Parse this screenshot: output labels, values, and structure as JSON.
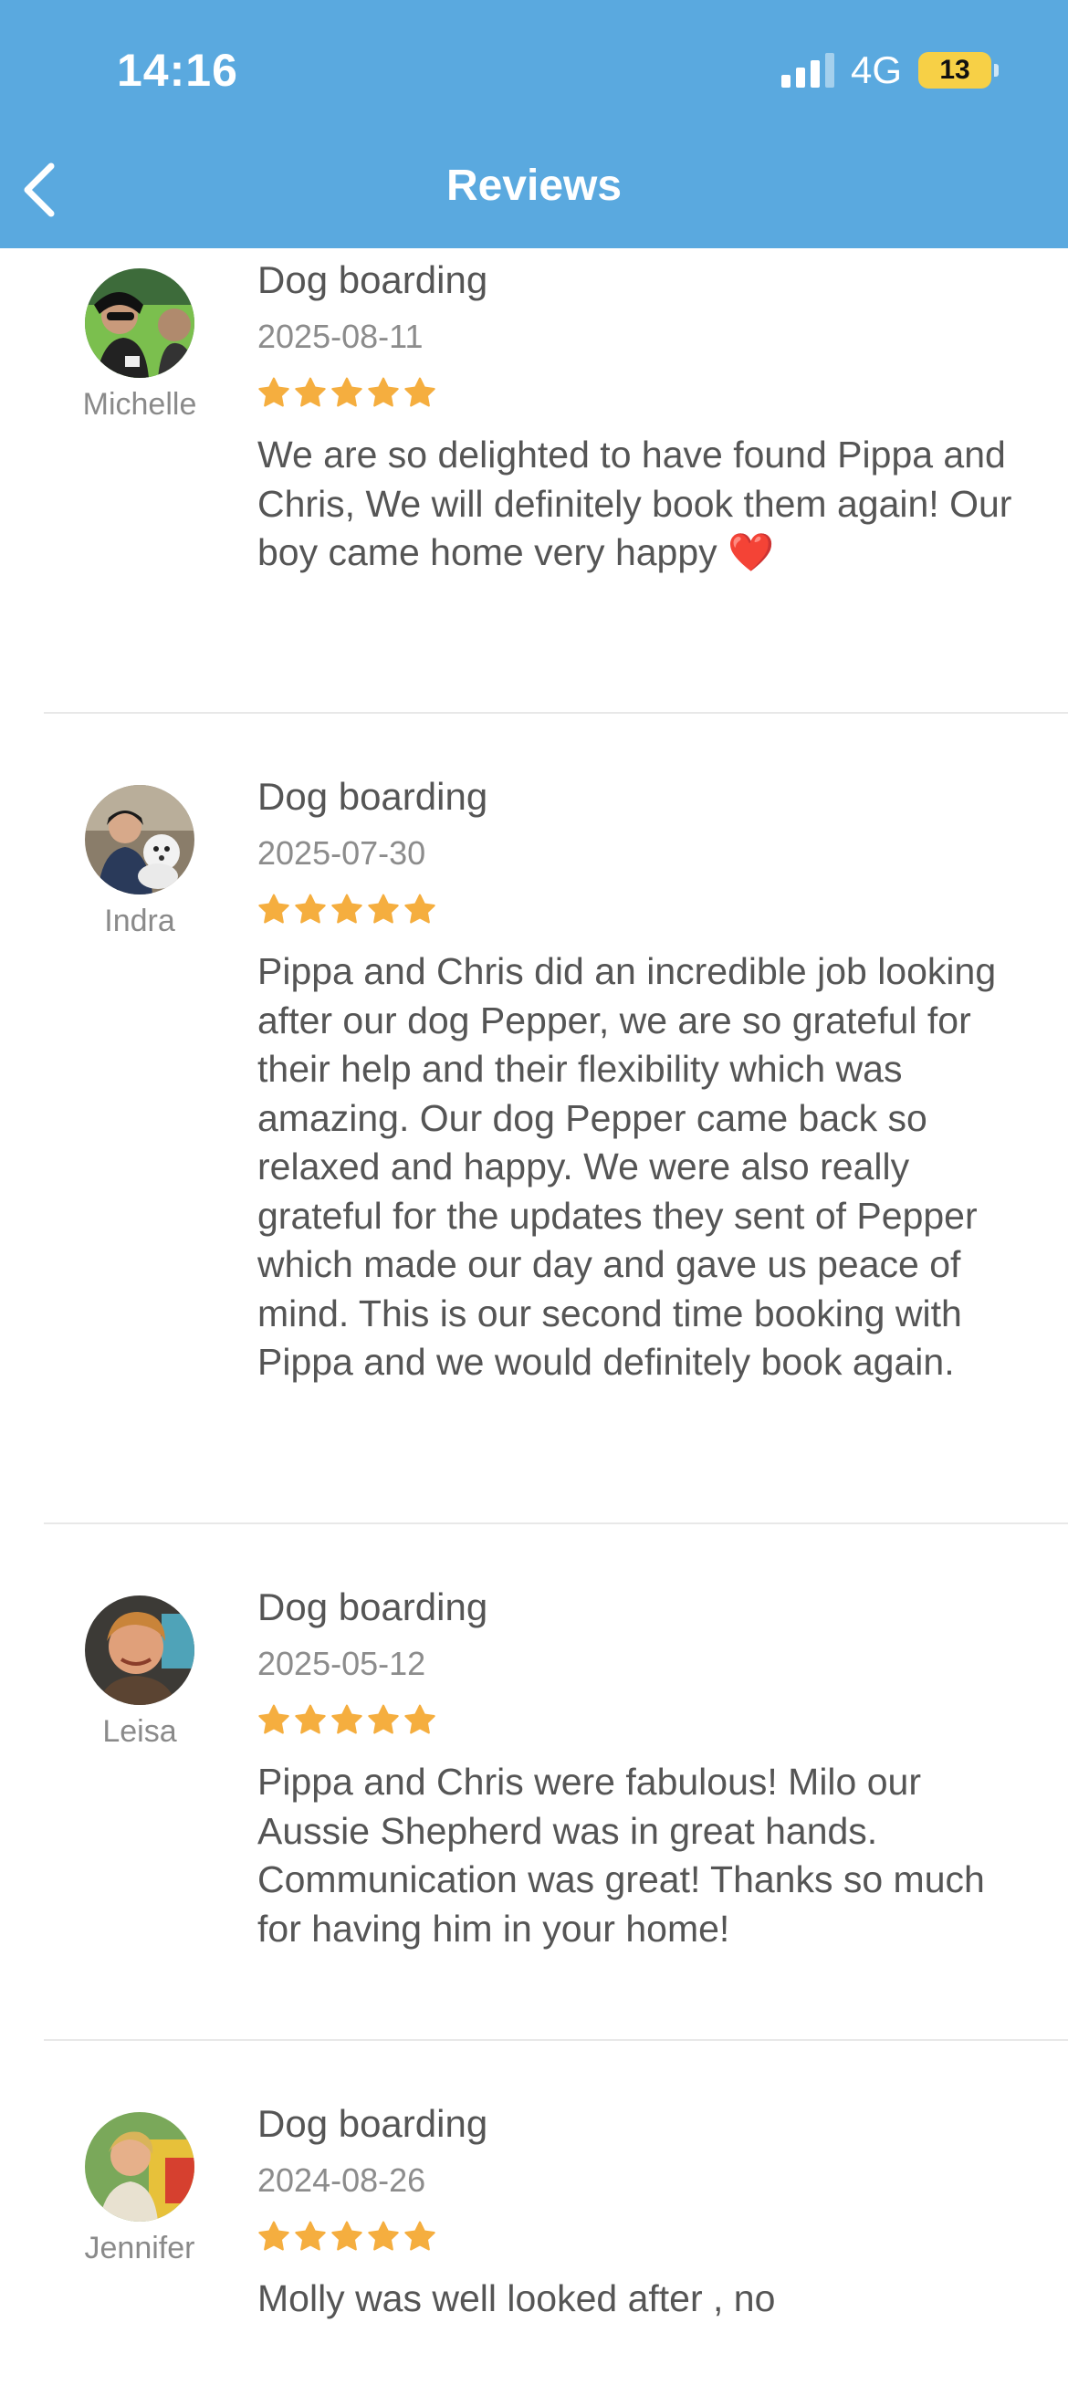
{
  "status_bar": {
    "time": "14:16",
    "network": "4G",
    "battery": "13"
  },
  "nav": {
    "title": "Reviews"
  },
  "colors": {
    "header": "#5AA9DF",
    "star": "#F5AE3F"
  },
  "reviews": [
    {
      "reviewer": "Michelle",
      "service": "Dog boarding",
      "date": "2025-08-11",
      "rating": 5,
      "text": "We are so delighted to have found Pippa and Chris, We will definitely book them again! Our boy came home very happy ❤️"
    },
    {
      "reviewer": "Indra",
      "service": "Dog boarding",
      "date": "2025-07-30",
      "rating": 5,
      "text": "Pippa and Chris did an incredible job looking after our dog Pepper, we are so grateful for their help and their flexibility which was amazing. Our dog Pepper came back so relaxed and happy. We were also really grateful for the updates they sent of Pepper which made our day and gave us peace of mind. This is our second time booking with Pippa and we would definitely book again."
    },
    {
      "reviewer": "Leisa",
      "service": "Dog boarding",
      "date": "2025-05-12",
      "rating": 5,
      "text": "Pippa and Chris were fabulous! Milo our Aussie Shepherd was in great hands. Communication was great! Thanks so much for having him in your home!"
    },
    {
      "reviewer": "Jennifer",
      "service": "Dog boarding",
      "date": "2024-08-26",
      "rating": 5,
      "text": "Molly was well looked after , no"
    }
  ]
}
